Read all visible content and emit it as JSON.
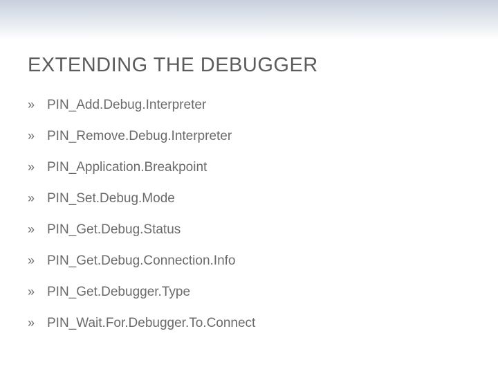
{
  "title": "EXTENDING THE DEBUGGER",
  "bullet_glyph": "»",
  "items": [
    "PIN_Add.Debug.Interpreter",
    "PIN_Remove.Debug.Interpreter",
    "PIN_Application.Breakpoint",
    "PIN_Set.Debug.Mode",
    "PIN_Get.Debug.Status",
    "PIN_Get.Debug.Connection.Info",
    "PIN_Get.Debugger.Type",
    "PIN_Wait.For.Debugger.To.Connect"
  ]
}
